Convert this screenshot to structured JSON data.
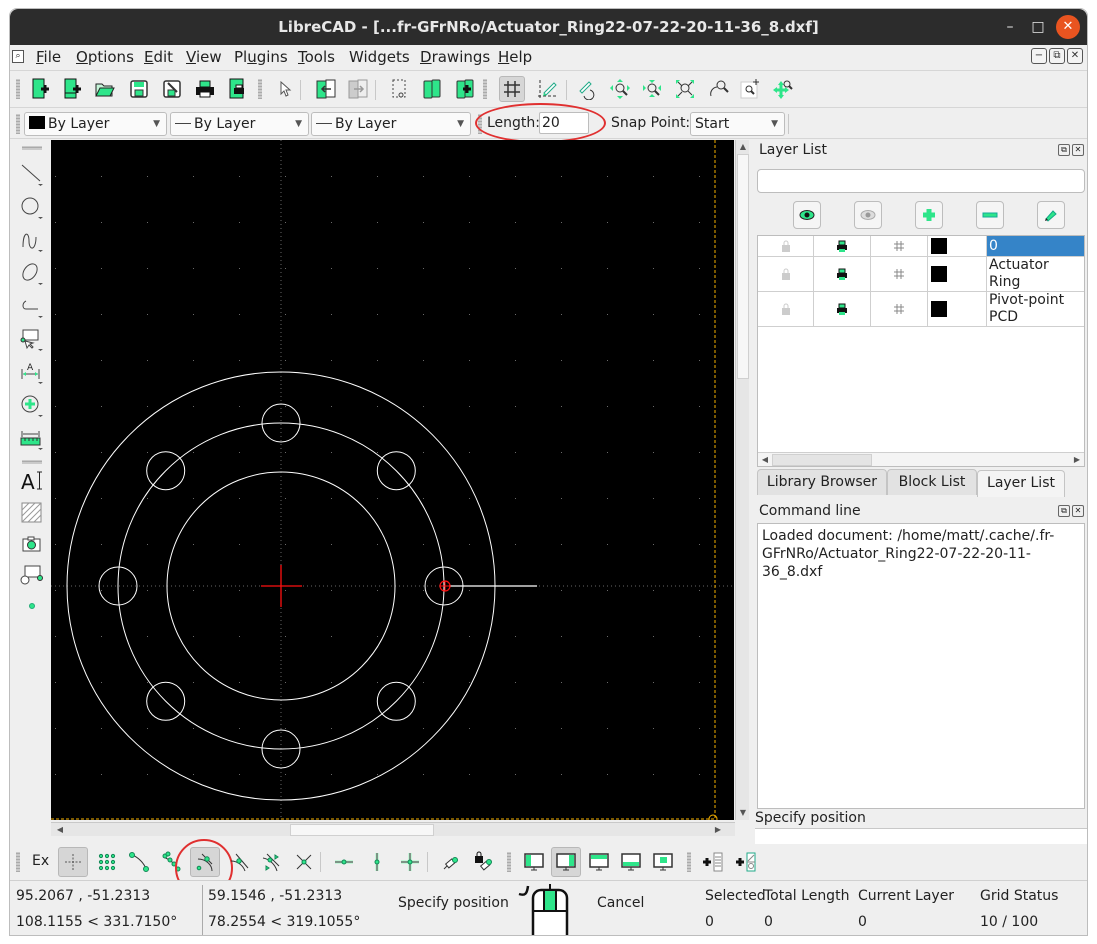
{
  "window": {
    "title": "LibreCAD - [...fr-GFrNRo/Actuator_Ring22-07-22-20-11-36_8.dxf]",
    "controls": {
      "minimize": "–",
      "maximize": "□",
      "close": "✕"
    }
  },
  "menubar": {
    "items": [
      {
        "label": "File",
        "mnemonic": "F"
      },
      {
        "label": "Options",
        "mnemonic": "O"
      },
      {
        "label": "Edit",
        "mnemonic": "E"
      },
      {
        "label": "View",
        "mnemonic": "V"
      },
      {
        "label": "Plugins",
        "mnemonic": "u"
      },
      {
        "label": "Tools",
        "mnemonic": "T"
      },
      {
        "label": "Widgets",
        "mnemonic": ""
      },
      {
        "label": "Drawings",
        "mnemonic": "D"
      },
      {
        "label": "Help",
        "mnemonic": "H"
      }
    ],
    "mdi_buttons": [
      "minimize-child-icon",
      "restore-child-icon",
      "close-child-icon"
    ]
  },
  "toolbar_main": {
    "icons": [
      "new-document-icon",
      "new-from-template-icon",
      "open-folder-icon",
      "save-icon",
      "save-as-icon",
      "print-icon",
      "print-preview-icon",
      "select-pointer-icon",
      "import-block-icon",
      "export-block-icon",
      "cut-selection-icon",
      "copy-icon",
      "paste-icon",
      "grid-toggle-icon",
      "draft-mode-icon",
      "redraw-icon",
      "zoom-in-icon",
      "zoom-out-icon",
      "zoom-auto-icon",
      "zoom-previous-icon",
      "zoom-window-icon",
      "zoom-pan-icon"
    ],
    "grid_active": true
  },
  "toolbar_pen": {
    "color": "By Layer",
    "linetype": "By Layer",
    "linewidth": "By Layer",
    "length_label": "Length:",
    "length_value": "20",
    "snap_point_label": "Snap Point:",
    "snap_point_value": "Start"
  },
  "left_tools": [
    "line-tool-icon",
    "circle-tool-icon",
    "spline-tool-icon",
    "ellipse-tool-icon",
    "polyline-tool-icon",
    "select-tool-icon",
    "dimension-tool-icon",
    "modify-tool-icon",
    "measure-tool-icon",
    "text-tool-icon",
    "hatch-tool-icon",
    "image-tool-icon",
    "block-tool-icon",
    "point-tool-icon"
  ],
  "canvas": {
    "background": "#000000",
    "entity_color": "#ffffff",
    "origin_marker_color": "#ff0000",
    "page_border_color": "#f5b000"
  },
  "layer_list": {
    "title": "Layer List",
    "filter_placeholder": "",
    "buttons": [
      "show-all-layers-icon",
      "hide-all-layers-icon",
      "add-layer-icon",
      "remove-layer-icon",
      "edit-layer-icon"
    ],
    "layers": [
      {
        "name": "0",
        "selected": true
      },
      {
        "name": "Actuator Ring",
        "selected": false
      },
      {
        "name": "Pivot-point PCD",
        "selected": false
      }
    ]
  },
  "dock_tabs": [
    {
      "label": "Library Browser",
      "active": false
    },
    {
      "label": "Block List",
      "active": false
    },
    {
      "label": "Layer List",
      "active": true
    }
  ],
  "command_line": {
    "title": "Command line",
    "output_line1": "Loaded document: /home/matt/.cache/.fr-",
    "output_line2": "GFrNRo/Actuator_Ring22-07-22-20-11-36_8.dxf",
    "prompt": "Specify position",
    "input_value": ""
  },
  "snap_toolbar": {
    "exclusive_label": "Ex",
    "icons": [
      "snap-free-icon",
      "snap-grid-icon",
      "snap-endpoint-icon",
      "snap-on-entity-icon",
      "snap-center-icon",
      "snap-middle-icon",
      "snap-distance-icon",
      "snap-intersection-icon",
      "restrict-horizontal-icon",
      "restrict-vertical-icon",
      "restrict-orthogonal-icon",
      "relative-zero-icon",
      "lock-relative-zero-icon",
      "dock-left-icon",
      "dock-right-icon",
      "dock-top-icon",
      "dock-bottom-icon",
      "dock-floating-icon",
      "add-list-icon",
      "add-block-icon"
    ],
    "active": [
      "snap-free-icon",
      "snap-center-icon",
      "dock-right-icon"
    ]
  },
  "status": {
    "abs_coord": "95.2067 , -51.2313",
    "abs_polar": "108.1155 < 331.7150°",
    "rel_coord": "59.1546 , -51.2313",
    "rel_polar": "78.2554 < 319.1055°",
    "mouse_left": "Specify position",
    "mouse_right": "Cancel",
    "selected_label": "Selected",
    "selected_value": "0",
    "total_length_label": "Total Length",
    "total_length_value": "0",
    "current_layer_label": "Current Layer",
    "current_layer_value": "0",
    "grid_status_label": "Grid Status",
    "grid_status_value": "10 / 100"
  }
}
